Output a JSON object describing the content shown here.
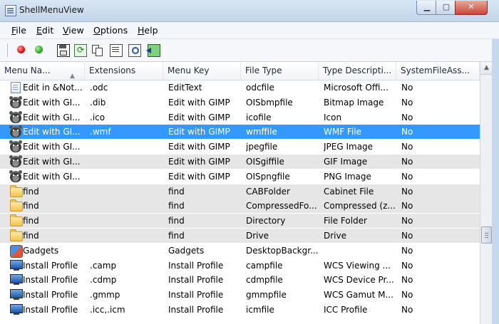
{
  "window": {
    "title": "ShellMenuView"
  },
  "menu": [
    {
      "label": "File",
      "accel": "F",
      "rest": "ile"
    },
    {
      "label": "Edit",
      "accel": "E",
      "rest": "dit"
    },
    {
      "label": "View",
      "accel": "V",
      "rest": "iew"
    },
    {
      "label": "Options",
      "accel": "O",
      "rest": "ptions"
    },
    {
      "label": "Help",
      "accel": "H",
      "rest": "elp"
    }
  ],
  "toolbar": [
    "red-dot-icon",
    "green-dot-icon",
    "save-icon",
    "refresh-icon",
    "copy-icon",
    "properties-icon",
    "find-icon",
    "exit-icon"
  ],
  "columns": [
    "Menu Na...",
    "Extensions",
    "Menu Key",
    "File Type",
    "Type Descripti...",
    "SystemFileAss..."
  ],
  "rows": [
    {
      "icon": "document-icon",
      "cells": [
        "Edit in &Not...",
        ".odc",
        "EditText",
        "odcfile",
        "Microsoft Offi...",
        "No"
      ],
      "style": "normal"
    },
    {
      "icon": "gimp-icon",
      "cells": [
        "Edit with GI...",
        ".dib",
        "Edit with GIMP",
        "OISbmpfile",
        "Bitmap Image",
        "No"
      ],
      "style": "normal"
    },
    {
      "icon": "gimp-icon",
      "cells": [
        "Edit with GI...",
        ".ico",
        "Edit with GIMP",
        "icofile",
        "Icon",
        "No"
      ],
      "style": "normal"
    },
    {
      "icon": "gimp-icon",
      "cells": [
        "Edit with GI...",
        ".wmf",
        "Edit with GIMP",
        "wmffile",
        "WMF File",
        "No"
      ],
      "style": "selected"
    },
    {
      "icon": "gimp-icon",
      "cells": [
        "Edit with GI...",
        "",
        "Edit with GIMP",
        "jpegfile",
        "JPEG Image",
        "No"
      ],
      "style": "normal"
    },
    {
      "icon": "gimp-icon",
      "cells": [
        "Edit with GI...",
        "",
        "Edit with GIMP",
        "OISgiffile",
        "GIF Image",
        "No"
      ],
      "style": "gray"
    },
    {
      "icon": "gimp-icon",
      "cells": [
        "Edit with GI...",
        "",
        "Edit with GIMP",
        "OISpngfile",
        "PNG Image",
        "No"
      ],
      "style": "normal"
    },
    {
      "icon": "folder-icon",
      "cells": [
        "find",
        "",
        "find",
        "CABFolder",
        "Cabinet File",
        "No"
      ],
      "style": "gray"
    },
    {
      "icon": "folder-icon",
      "cells": [
        "find",
        "",
        "find",
        "CompressedFo...",
        "Compressed (z...",
        "No"
      ],
      "style": "gray"
    },
    {
      "icon": "folder-icon",
      "cells": [
        "find",
        "",
        "find",
        "Directory",
        "File Folder",
        "No"
      ],
      "style": "gray"
    },
    {
      "icon": "folder-icon",
      "cells": [
        "find",
        "",
        "find",
        "Drive",
        "Drive",
        "No"
      ],
      "style": "gray"
    },
    {
      "icon": "gadgets-icon",
      "cells": [
        "Gadgets",
        "",
        "Gadgets",
        "DesktopBackgr...",
        "",
        "No"
      ],
      "style": "normal"
    },
    {
      "icon": "monitor-icon",
      "cells": [
        "Install Profile",
        ".camp",
        "Install Profile",
        "campfile",
        "WCS Viewing ...",
        "No"
      ],
      "style": "normal"
    },
    {
      "icon": "monitor-icon",
      "cells": [
        "Install Profile",
        ".cdmp",
        "Install Profile",
        "cdmpfile",
        "WCS Device Pr...",
        "No"
      ],
      "style": "normal"
    },
    {
      "icon": "monitor-icon",
      "cells": [
        "Install Profile",
        ".gmmp",
        "Install Profile",
        "gmmpfile",
        "WCS Gamut M...",
        "No"
      ],
      "style": "normal"
    },
    {
      "icon": "monitor-icon",
      "cells": [
        "Install Profile",
        ".icc,.icm",
        "Install Profile",
        "icmfile",
        "ICC Profile",
        "No"
      ],
      "style": "normal"
    }
  ]
}
